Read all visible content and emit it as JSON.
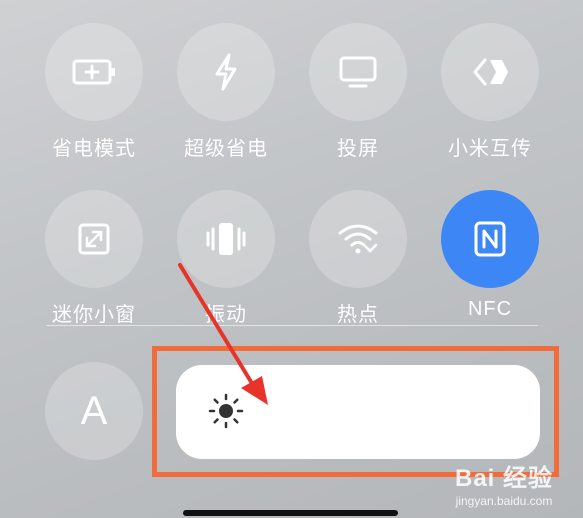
{
  "tiles": [
    {
      "label": "省电模式",
      "icon": "battery-icon"
    },
    {
      "label": "超级省电",
      "icon": "lightning-icon"
    },
    {
      "label": "投屏",
      "icon": "monitor-icon"
    },
    {
      "label": "小米互传",
      "icon": "mi-share-icon"
    },
    {
      "label": "迷你小窗",
      "icon": "floating-window-icon"
    },
    {
      "label": "振动",
      "icon": "vibrate-icon"
    },
    {
      "label": "热点",
      "icon": "hotspot-icon"
    },
    {
      "label": "NFC",
      "icon": "nfc-icon",
      "active": true
    }
  ],
  "font_button": {
    "glyph": "A"
  },
  "brightness": {
    "icon": "sun-icon"
  },
  "watermark": {
    "brand": "Bai 经验",
    "url": "jingyan.baidu.com"
  },
  "colors": {
    "active": "#3d86f5",
    "highlight": "#f26b3a",
    "arrow": "#e8332a"
  }
}
